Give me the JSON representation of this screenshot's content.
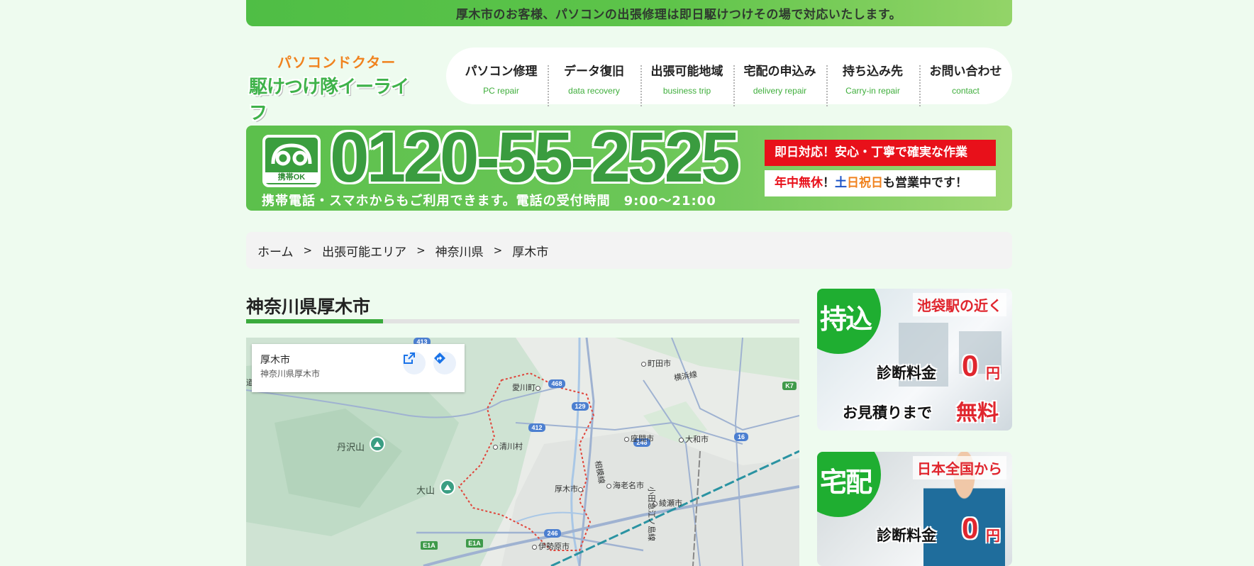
{
  "top_banner": "厚木市のお客様、パソコンの出張修理は即日駆けつけその場で対応いたします。",
  "logo": {
    "line1": "パソコンドクター",
    "line2": "駆けつけ隊イーライフ"
  },
  "nav": [
    {
      "label": "パソコン修理",
      "sub": "PC repair"
    },
    {
      "label": "データ復旧",
      "sub": "data recovery"
    },
    {
      "label": "出張可能地域",
      "sub": "business trip"
    },
    {
      "label": "宅配の申込み",
      "sub": "delivery repair"
    },
    {
      "label": "持ち込み先",
      "sub": "Carry-in repair"
    },
    {
      "label": "お問い合わせ",
      "sub": "contact"
    }
  ],
  "phone": {
    "icon_label": "携帯OK",
    "number": "0120-55-2525",
    "note": "携帯電話・スマホからもご利用できます。電話の受付時間　9:00～21:00",
    "badge1": "即日対応！安心・丁寧で確実な作業",
    "badge2": {
      "p1": "年中無休",
      "p2": "！",
      "p3": "土",
      "p4": "日祝日",
      "p5": "も営業中です！"
    }
  },
  "breadcrumb": [
    {
      "label": "ホーム"
    },
    {
      "label": "出張可能エリア"
    },
    {
      "label": "神奈川県"
    },
    {
      "label": "厚木市"
    }
  ],
  "breadcrumb_sep": ">",
  "page_title": "神奈川県厚木市",
  "map": {
    "place_name": "厚木市",
    "place_address": "神奈川県厚木市",
    "labels": {
      "machida": "町田市",
      "yokohama_line": "横浜線",
      "aikawa": "愛川町",
      "kiyokawa": "清川村",
      "zama": "座間市",
      "yamato": "大和市",
      "tanzawa": "丹沢山",
      "oyama": "大山",
      "atsugi": "厚木市",
      "ebina": "海老名市",
      "ayase": "綾瀬市",
      "isehara": "伊勢原市",
      "odakyu": "小田急江ノ島線",
      "sagami": "相模線",
      "michi": "道"
    },
    "shields": [
      "413",
      "468",
      "129",
      "412",
      "246",
      "16",
      "K7",
      "246",
      "E1A",
      "E1A"
    ]
  },
  "side_banners": [
    {
      "tag": "池袋駅の近く",
      "bubble": "持込",
      "fee": "診断料金",
      "zero": "0",
      "yen": "円",
      "estimate": "お見積りまで",
      "free": "無料"
    },
    {
      "tag": "日本全国から",
      "bubble": "宅配",
      "fee": "診断料金",
      "zero": "0",
      "yen": "円"
    }
  ],
  "colors": {
    "brand_green": "#3aaa3c",
    "accent_red": "#e8101a",
    "accent_orange": "#f0821e",
    "page_bg": "#eefbef"
  }
}
